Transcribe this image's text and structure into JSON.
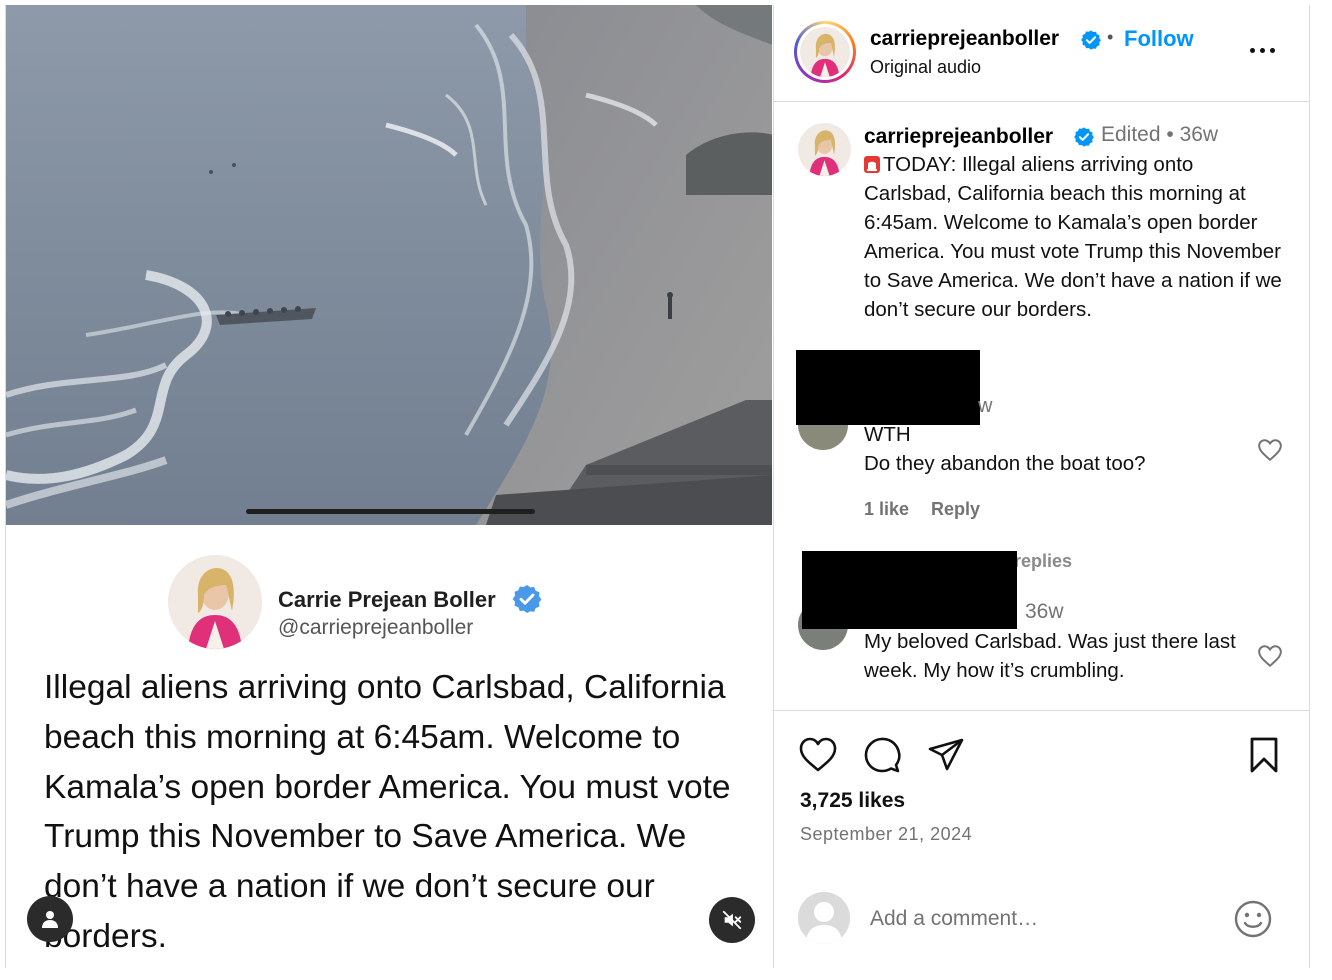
{
  "post": {
    "username": "carrieprejeanboller",
    "follow_label": "Follow",
    "separator": "•",
    "audio_label": "Original audio"
  },
  "tweet": {
    "display_name": "Carrie Prejean Boller",
    "handle": "@carrieprejeanboller",
    "text": "Illegal aliens arriving onto Carlsbad, California beach this morning at 6:45am. Welcome to Kamala’s open border America. You must vote Trump this November to Save America. We don’t have a nation if we don’t secure our borders."
  },
  "caption": {
    "username": "carrieprejeanboller",
    "meta": "Edited • 36w",
    "text": "TODAY: Illegal aliens arriving onto Carlsbad, California beach this morning at 6:45am. Welcome to Kamala’s open border America. You must vote Trump this November to Save America. We don’t have a nation if we don’t secure our borders."
  },
  "comments": [
    {
      "time_fragment": "w",
      "text": "WTH\nDo they abandon the boat too?",
      "likes": "1 like",
      "reply_label": "Reply"
    },
    {
      "replies_fragment": "replies",
      "time_fragment": "36w",
      "text": "My beloved Carlsbad. Was just there last week. My how it’s crumbling."
    }
  ],
  "engagement": {
    "likes": "3,725 likes",
    "date": "September 21, 2024"
  },
  "add_comment": {
    "placeholder": "Add a comment…"
  },
  "icons": {
    "verified": "verified-badge-icon",
    "more": "more-options-icon",
    "like": "heart-icon",
    "comment": "comment-bubble-icon",
    "share": "paper-plane-icon",
    "save": "bookmark-icon",
    "emoji": "emoji-icon",
    "user": "person-icon",
    "mute": "speaker-muted-icon"
  },
  "colors": {
    "accent": "#0095f6",
    "verified": "#0095f6",
    "muted_text": "#737373",
    "border": "#dbdbdb"
  }
}
